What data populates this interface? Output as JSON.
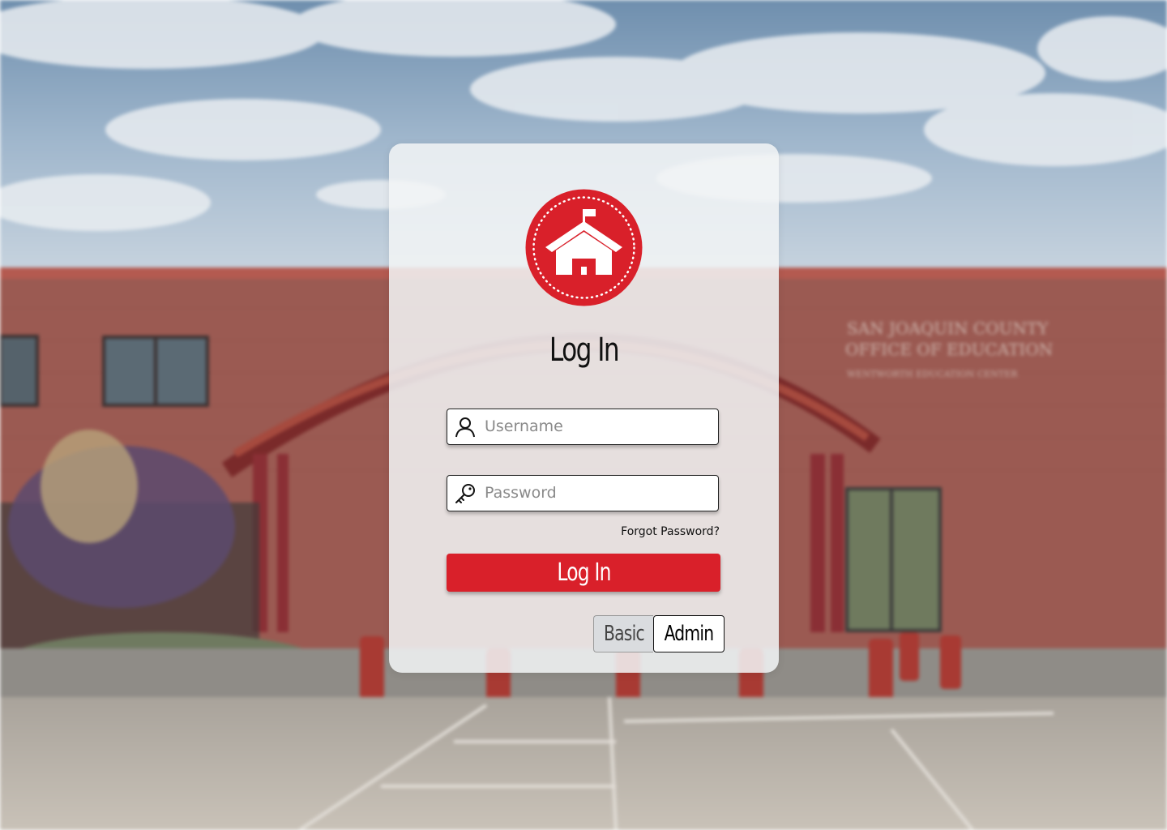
{
  "login": {
    "title": "Log In",
    "username_placeholder": "Username",
    "password_placeholder": "Password",
    "forgot_password": "Forgot Password?",
    "submit_label": "Log In",
    "mode_toggle": {
      "options": [
        "Basic",
        "Admin"
      ],
      "selected": "Admin"
    }
  },
  "background": {
    "building_sign": {
      "line1": "SAN JOAQUIN COUNTY",
      "line2": "OFFICE OF EDUCATION",
      "line3": "WENTWORTH EDUCATION CENTER"
    }
  },
  "colors": {
    "brand_red": "#d9202a",
    "card": "#f2f4f6"
  },
  "icons": {
    "logo": "schoolhouse-icon",
    "username": "user-icon",
    "password": "key-icon"
  }
}
